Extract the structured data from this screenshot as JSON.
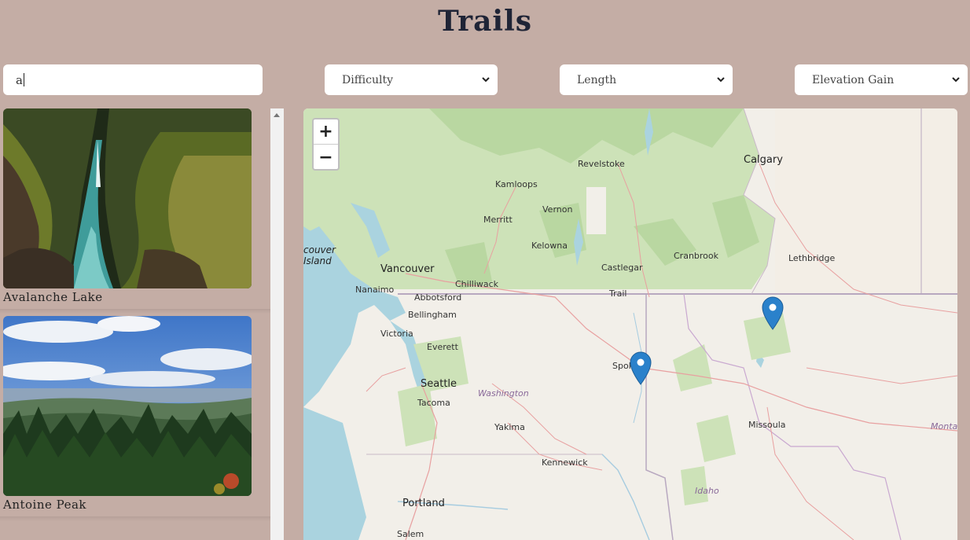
{
  "page": {
    "title": "Trails"
  },
  "search": {
    "value": "a"
  },
  "filters": {
    "difficulty": "Difficulty",
    "length": "Length",
    "elevation": "Elevation Gain"
  },
  "trails": [
    {
      "name": "Avalanche Lake"
    },
    {
      "name": "Antoine Peak"
    }
  ],
  "map": {
    "zoom_in": "+",
    "zoom_out": "−",
    "labels": {
      "calgary": "Calgary",
      "revelstoke": "Revelstoke",
      "kamloops": "Kamloops",
      "merritt": "Merritt",
      "vernon": "Vernon",
      "kelowna": "Kelowna",
      "castlegar": "Castlegar",
      "cranbrook": "Cranbrook",
      "lethbridge": "Lethbridge",
      "island": "couver\nIsland",
      "vancouver": "Vancouver",
      "nanaimo": "Nanaimo",
      "chilliwack": "Chilliwack",
      "abbotsford": "Abbotsford",
      "trail": "Trail",
      "bellingham": "Bellingham",
      "victoria": "Victoria",
      "everett": "Everett",
      "spokane": "Spok",
      "seattle": "Seattle",
      "washington": "Washington",
      "tacoma": "Tacoma",
      "missoula": "Missoula",
      "montana": "Montar",
      "yakima": "Yakima",
      "kennewick": "Kennewick",
      "idaho": "Idaho",
      "portland": "Portland",
      "salem": "Salem"
    }
  },
  "colors": {
    "background": "#c4ada5",
    "marker": "#2a81cb"
  }
}
